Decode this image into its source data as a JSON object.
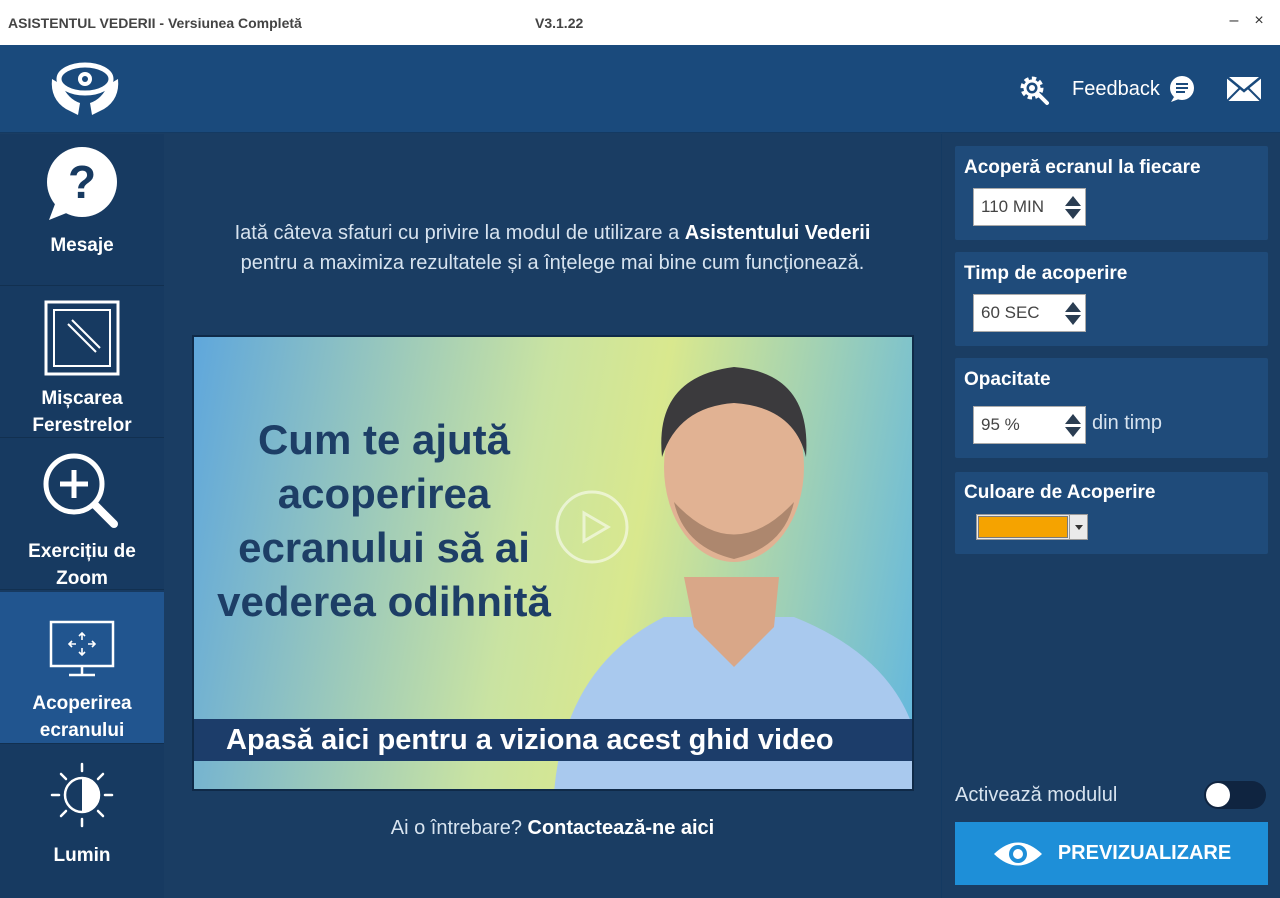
{
  "window": {
    "title": "ASISTENTUL VEDERII - Versiunea Completă",
    "version": "V3.1.22",
    "minimize_label": "–",
    "close_label": "×"
  },
  "header": {
    "logo_icon": "eye-hands-icon",
    "feedback_label": "Feedback"
  },
  "sidebar": {
    "items": [
      {
        "label": "Mesaje",
        "icon": "question-bubble-icon"
      },
      {
        "label": "Mișcarea Ferestrelor",
        "icon": "window-move-icon"
      },
      {
        "label": "Exercițiu de Zoom",
        "icon": "zoom-in-icon"
      },
      {
        "label": "Acoperirea ecranului",
        "icon": "screen-cover-icon",
        "active": true
      },
      {
        "label": "Lumin",
        "icon": "brightness-icon"
      }
    ]
  },
  "main": {
    "intro_part1": "Iată câteva sfaturi cu privire la modul de utilizare a ",
    "intro_bold": "Asistentului Vederii",
    "intro_part2": "pentru a maximiza rezultatele și a înțelege mai bine cum funcționează.",
    "video_headline": "Cum te ajută acoperirea ecranului să ai vederea odihnită",
    "video_banner": "Apasă aici pentru a viziona acest ghid video",
    "question_text": "Ai o întrebare? ",
    "contact_link": "Contactează-ne aici"
  },
  "settings": {
    "cover_every_label": "Acoperă ecranul la fiecare",
    "cover_every_value": "110 MIN",
    "cover_time_label": "Timp de acoperire",
    "cover_time_value": "60 SEC",
    "opacity_label": "Opacitate",
    "opacity_value": "95 %",
    "opacity_suffix": "din timp",
    "color_label": "Culoare de Acoperire",
    "color_value": "#f5a300",
    "activate_label": "Activează modulul",
    "activate_on": false,
    "preview_label": "PREVIZUALIZARE"
  }
}
